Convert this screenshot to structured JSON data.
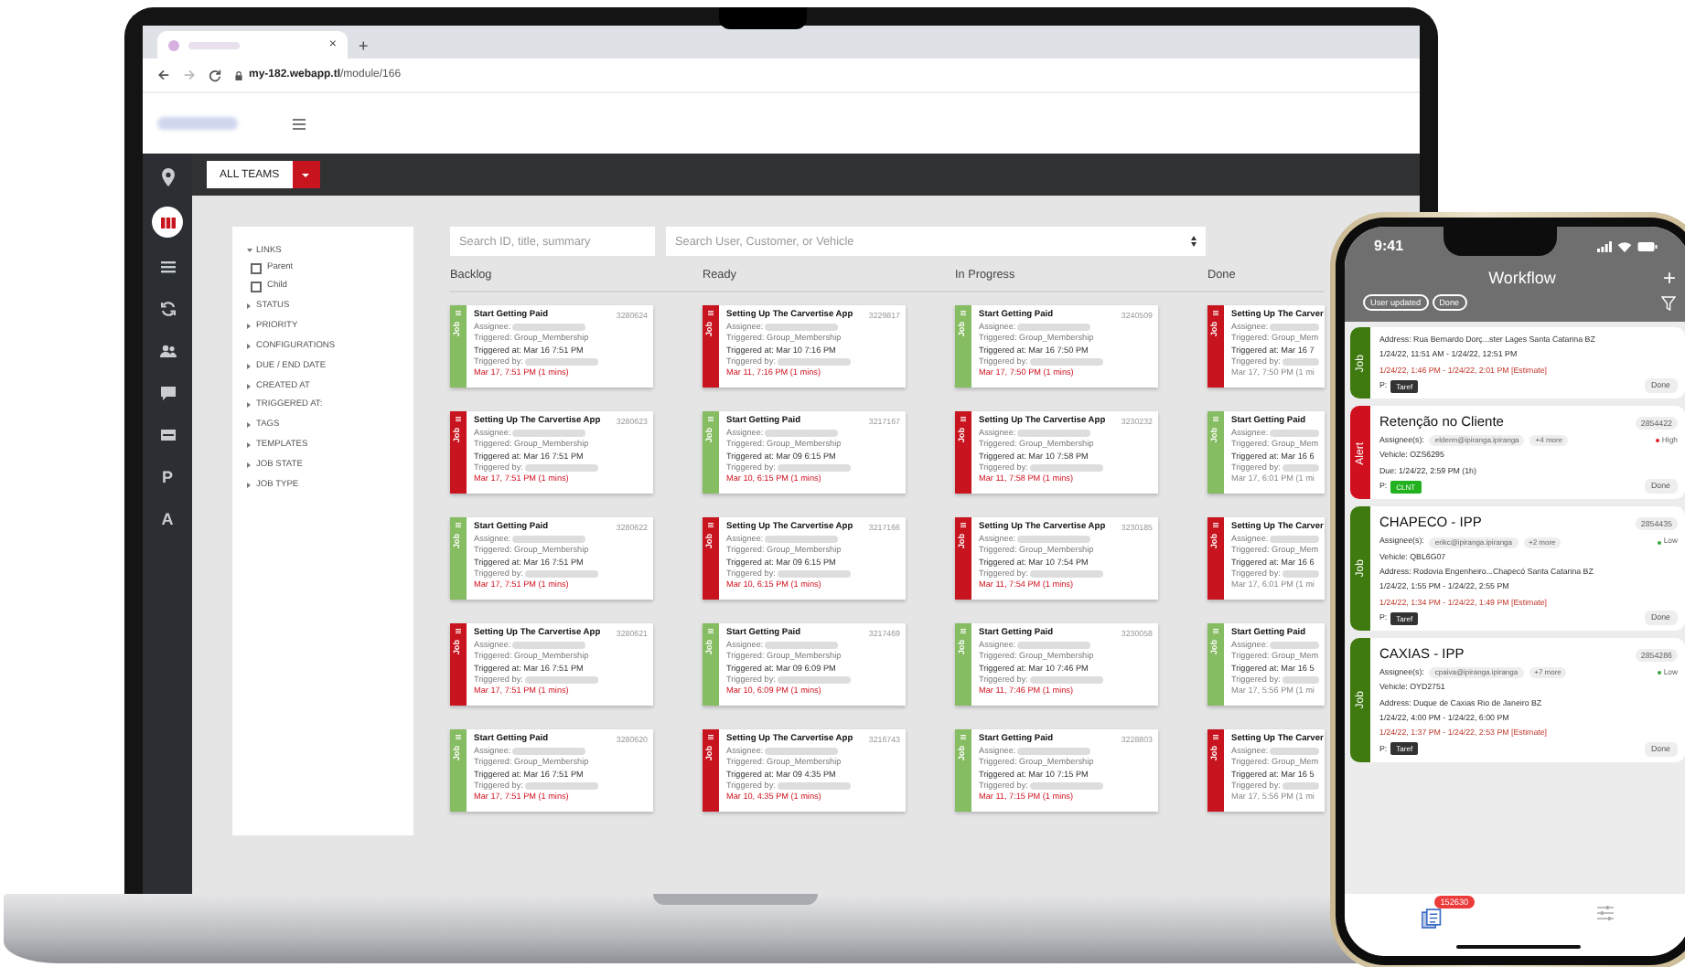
{
  "browser": {
    "tab_close": "×",
    "new_tab": "+",
    "url_host": "my-182.webapp.tl",
    "url_path": "/module/166"
  },
  "sidebar": [
    {
      "kind": "pin",
      "selected": false
    },
    {
      "kind": "board",
      "selected": true
    },
    {
      "kind": "list",
      "selected": false
    },
    {
      "kind": "sync",
      "selected": false
    },
    {
      "kind": "people",
      "selected": false
    },
    {
      "kind": "chat",
      "selected": false
    },
    {
      "kind": "tray",
      "selected": false
    },
    {
      "kind": "letter",
      "label": "P",
      "selected": false
    },
    {
      "kind": "letter",
      "label": "A",
      "selected": false
    }
  ],
  "toolbar": {
    "team": "ALL TEAMS"
  },
  "filters": [
    {
      "label": "LINKS",
      "expanded": true,
      "options": [
        {
          "label": "Parent",
          "checked": false
        },
        {
          "label": "Child",
          "checked": false
        }
      ]
    },
    {
      "label": "STATUS",
      "expanded": false
    },
    {
      "label": "PRIORITY",
      "expanded": false
    },
    {
      "label": "CONFIGURATIONS",
      "expanded": false
    },
    {
      "label": "DUE / END DATE",
      "expanded": false
    },
    {
      "label": "CREATED AT",
      "expanded": false
    },
    {
      "label": "TRIGGERED AT:",
      "expanded": false
    },
    {
      "label": "TAGS",
      "expanded": false
    },
    {
      "label": "TEMPLATES",
      "expanded": false
    },
    {
      "label": "JOB STATE",
      "expanded": false
    },
    {
      "label": "JOB TYPE",
      "expanded": false
    }
  ],
  "search": [
    {
      "placeholder": "Search ID, title, summary",
      "kind": "text"
    },
    {
      "placeholder": "Search User, Customer, or Vehicle",
      "kind": "select"
    }
  ],
  "columns": [
    {
      "title": "Backlog",
      "cards": [
        {
          "tag": "Job",
          "color": "#86bc62",
          "title": "Start Getting Paid",
          "id": "3280624",
          "assignee": "Assignee:",
          "triggered": "Triggered: Group_Membership",
          "triggered_at": "Triggered at: Mar 16 7:51 PM",
          "triggered_by": "Triggered by:",
          "due": "Mar 17, 7:51 PM  (1 mins)",
          "overdue": true
        },
        {
          "tag": "Job",
          "color": "#c8141e",
          "title": "Setting Up The Carvertise App",
          "id": "3280623",
          "assignee": "Assignee:",
          "triggered": "Triggered: Group_Membership",
          "triggered_at": "Triggered at: Mar 16 7:51 PM",
          "triggered_by": "Triggered by:",
          "due": "Mar 17, 7:51 PM  (1 mins)",
          "overdue": true
        },
        {
          "tag": "Job",
          "color": "#86bc62",
          "title": "Start Getting Paid",
          "id": "3280622",
          "assignee": "Assignee:",
          "triggered": "Triggered: Group_Membership",
          "triggered_at": "Triggered at: Mar 16 7:51 PM",
          "triggered_by": "Triggered by:",
          "due": "Mar 17, 7:51 PM  (1 mins)",
          "overdue": true
        },
        {
          "tag": "Job",
          "color": "#c8141e",
          "title": "Setting Up The Carvertise App",
          "id": "3280621",
          "assignee": "Assignee:",
          "triggered": "Triggered: Group_Membership",
          "triggered_at": "Triggered at: Mar 16 7:51 PM",
          "triggered_by": "Triggered by:",
          "due": "Mar 17, 7:51 PM  (1 mins)",
          "overdue": true
        },
        {
          "tag": "Job",
          "color": "#86bc62",
          "title": "Start Getting Paid",
          "id": "3280620",
          "assignee": "Assignee:",
          "triggered": "Triggered: Group_Membership",
          "triggered_at": "Triggered at: Mar 16 7:51 PM",
          "triggered_by": "Triggered by:",
          "due": "Mar 17, 7:51 PM  (1 mins)",
          "overdue": true
        }
      ]
    },
    {
      "title": "Ready",
      "cards": [
        {
          "tag": "Job",
          "color": "#c8141e",
          "title": "Setting Up The Carvertise App",
          "id": "3229817",
          "assignee": "Assignee:",
          "triggered": "Triggered: Group_Membership",
          "triggered_at": "Triggered at: Mar 10 7:16 PM",
          "triggered_by": "Triggered by:",
          "due": "Mar 11, 7:16 PM  (1 mins)",
          "overdue": true
        },
        {
          "tag": "Job",
          "color": "#86bc62",
          "title": "Start Getting Paid",
          "id": "3217167",
          "assignee": "Assignee:",
          "triggered": "Triggered: Group_Membership",
          "triggered_at": "Triggered at: Mar 09 6:15 PM",
          "triggered_by": "Triggered by:",
          "due": "Mar 10, 6:15 PM  (1 mins)",
          "overdue": true
        },
        {
          "tag": "Job",
          "color": "#c8141e",
          "title": "Setting Up The Carvertise App",
          "id": "3217166",
          "assignee": "Assignee:",
          "triggered": "Triggered: Group_Membership",
          "triggered_at": "Triggered at: Mar 09 6:15 PM",
          "triggered_by": "Triggered by:",
          "due": "Mar 10, 6:15 PM  (1 mins)",
          "overdue": true
        },
        {
          "tag": "Job",
          "color": "#86bc62",
          "title": "Start Getting Paid",
          "id": "3217469",
          "assignee": "Assignee:",
          "triggered": "Triggered: Group_Membership",
          "triggered_at": "Triggered at: Mar 09 6:09 PM",
          "triggered_by": "Triggered by:",
          "due": "Mar 10, 6:09 PM  (1 mins)",
          "overdue": true
        },
        {
          "tag": "Job",
          "color": "#c8141e",
          "title": "Setting Up The Carvertise App",
          "id": "3216743",
          "assignee": "Assignee:",
          "triggered": "Triggered: Group_Membership",
          "triggered_at": "Triggered at: Mar 09 4:35 PM",
          "triggered_by": "Triggered by:",
          "due": "Mar 10, 4:35 PM  (1 mins)",
          "overdue": true
        }
      ]
    },
    {
      "title": "In Progress",
      "cards": [
        {
          "tag": "Job",
          "color": "#86bc62",
          "title": "Start Getting Paid",
          "id": "3240509",
          "assignee": "Assignee:",
          "triggered": "Triggered: Group_Membership",
          "triggered_at": "Triggered at: Mar 16 7:50 PM",
          "triggered_by": "Triggered by:",
          "due": "Mar 17, 7:50 PM  (1 mins)",
          "overdue": true
        },
        {
          "tag": "Job",
          "color": "#c8141e",
          "title": "Setting Up The Carvertise App",
          "id": "3230232",
          "assignee": "Assignee:",
          "triggered": "Triggered: Group_Membership",
          "triggered_at": "Triggered at: Mar 10 7:58 PM",
          "triggered_by": "Triggered by:",
          "due": "Mar 11, 7:58 PM  (1 mins)",
          "overdue": true
        },
        {
          "tag": "Job",
          "color": "#c8141e",
          "title": "Setting Up The Carvertise App",
          "id": "3230185",
          "assignee": "Assignee:",
          "triggered": "Triggered: Group_Membership",
          "triggered_at": "Triggered at: Mar 10 7:54 PM",
          "triggered_by": "Triggered by:",
          "due": "Mar 11, 7:54 PM  (1 mins)",
          "overdue": true
        },
        {
          "tag": "Job",
          "color": "#86bc62",
          "title": "Start Getting Paid",
          "id": "3230058",
          "assignee": "Assignee:",
          "triggered": "Triggered: Group_Membership",
          "triggered_at": "Triggered at: Mar 10 7:46 PM",
          "triggered_by": "Triggered by:",
          "due": "Mar 11, 7:46 PM  (1 mins)",
          "overdue": true
        },
        {
          "tag": "Job",
          "color": "#86bc62",
          "title": "Start Getting Paid",
          "id": "3228803",
          "assignee": "Assignee:",
          "triggered": "Triggered: Group_Membership",
          "triggered_at": "Triggered at: Mar 10 7:15 PM",
          "triggered_by": "Triggered by:",
          "due": "Mar 11, 7:15 PM  (1 mins)",
          "overdue": true
        }
      ]
    },
    {
      "title": "Done",
      "cards": [
        {
          "tag": "Job",
          "color": "#c8141e",
          "title": "Setting Up The Carver",
          "assignee": "Assignee:",
          "triggered": "Triggered: Group_Mem",
          "triggered_at": "Triggered at: Mar 16 7",
          "triggered_by": "Triggered by:",
          "due": "Mar 17, 7:50 PM  (1 mi",
          "overdue": false
        },
        {
          "tag": "Job",
          "color": "#86bc62",
          "title": "Start Getting Paid",
          "assignee": "Assignee:",
          "triggered": "Triggered: Group_Mem",
          "triggered_at": "Triggered at: Mar 16 6",
          "triggered_by": "Triggered by:",
          "due": "Mar 17, 6:01 PM  (1 mi",
          "overdue": false
        },
        {
          "tag": "Job",
          "color": "#c8141e",
          "title": "Setting Up The Carver",
          "assignee": "Assignee:",
          "triggered": "Triggered: Group_Mem",
          "triggered_at": "Triggered at: Mar 16 6",
          "triggered_by": "Triggered by:",
          "due": "Mar 17, 6:01 PM  (1 mi",
          "overdue": false
        },
        {
          "tag": "Job",
          "color": "#86bc62",
          "title": "Start Getting Paid",
          "assignee": "Assignee:",
          "triggered": "Triggered: Group_Mem",
          "triggered_at": "Triggered at: Mar 16 5",
          "triggered_by": "Triggered by:",
          "due": "Mar 17, 5:56 PM  (1 mi",
          "overdue": false
        },
        {
          "tag": "Job",
          "color": "#c8141e",
          "title": "Setting Up The Carver",
          "assignee": "Assignee:",
          "triggered": "Triggered: Group_Mem",
          "triggered_at": "Triggered at: Mar 16 5",
          "triggered_by": "Triggered by:",
          "due": "Mar 17, 5:56 PM  (1 mi",
          "overdue": false
        }
      ]
    }
  ],
  "phone": {
    "time": "9:41",
    "title": "Workflow",
    "add": "+",
    "chips": [
      {
        "label": "User updated"
      },
      {
        "label": "Done"
      }
    ],
    "cards": [
      {
        "tag": "Job",
        "color": "#3f7a10",
        "lines": [
          {
            "text": "Address: Rua Bernardo Dorç...ster Lages Santa Catarina BZ",
            "kind": "plain"
          },
          {
            "text": "1/24/22, 11:51 AM - 1/24/22, 12:51 PM",
            "kind": "plain"
          },
          {
            "text": "1/24/22, 1:46 PM - 1/24/22, 2:01 PM [Estimate]",
            "kind": "estimate"
          }
        ],
        "p_label": "P:",
        "chip": {
          "text": "Taref",
          "color": "#333333"
        },
        "action": "Done"
      },
      {
        "tag": "Alert",
        "color": "#d0101e",
        "title": "Retenção no Cliente",
        "id": "2854422",
        "assignee": {
          "label": "Assignee(s):",
          "email": "elderm@ipiranga.ipiranga",
          "more": "+4 more",
          "priority": {
            "label": "High",
            "color": "#e02020"
          }
        },
        "lines": [
          {
            "text": "Vehicle: OZS6295",
            "kind": "plain"
          },
          {
            "text": "Due: 1/24/22, 2:59 PM (1h)",
            "kind": "plain"
          }
        ],
        "p_label": "P:",
        "chip": {
          "text": "CLNT",
          "color": "#22b21f"
        },
        "action": "Done"
      },
      {
        "tag": "Job",
        "color": "#3f7a10",
        "title": "CHAPECO - IPP",
        "id": "2854435",
        "assignee": {
          "label": "Assignee(s):",
          "email": "erikc@ipiranga.ipiranga",
          "more": "+2 more",
          "priority": {
            "label": "Low",
            "color": "#3aa53a"
          }
        },
        "lines": [
          {
            "text": "Vehicle: QBL6G07",
            "kind": "plain"
          },
          {
            "text": "Address: Rodovia Engenheiro...Chapecó Santa Catarina BZ",
            "kind": "plain"
          },
          {
            "text": "1/24/22, 1:55 PM - 1/24/22, 2:55 PM",
            "kind": "plain"
          },
          {
            "text": "1/24/22, 1:34 PM - 1/24/22, 1:49 PM [Estimate]",
            "kind": "estimate"
          }
        ],
        "p_label": "P:",
        "chip": {
          "text": "Taref",
          "color": "#333333"
        },
        "action": "Done"
      },
      {
        "tag": "Job",
        "color": "#3f7a10",
        "title": "CAXIAS - IPP",
        "id": "2854286",
        "assignee": {
          "label": "Assignee(s):",
          "email": "cpaiva@ipiranga.ipiranga",
          "more": "+7 more",
          "priority": {
            "label": "Low",
            "color": "#3aa53a"
          }
        },
        "lines": [
          {
            "text": "Vehicle: OYD2751",
            "kind": "plain"
          },
          {
            "text": "Address: Duque de Caxias Rio de Janeiro BZ",
            "kind": "plain"
          },
          {
            "text": "1/24/22, 4:00 PM - 1/24/22, 6:00 PM",
            "kind": "plain"
          },
          {
            "text": "1/24/22, 1:37 PM - 1/24/22, 2:53 PM [Estimate]",
            "kind": "estimate"
          }
        ],
        "p_label": "P:",
        "chip": {
          "text": "Taref",
          "color": "#333333"
        },
        "action": "Done"
      }
    ],
    "badge": "152630"
  }
}
